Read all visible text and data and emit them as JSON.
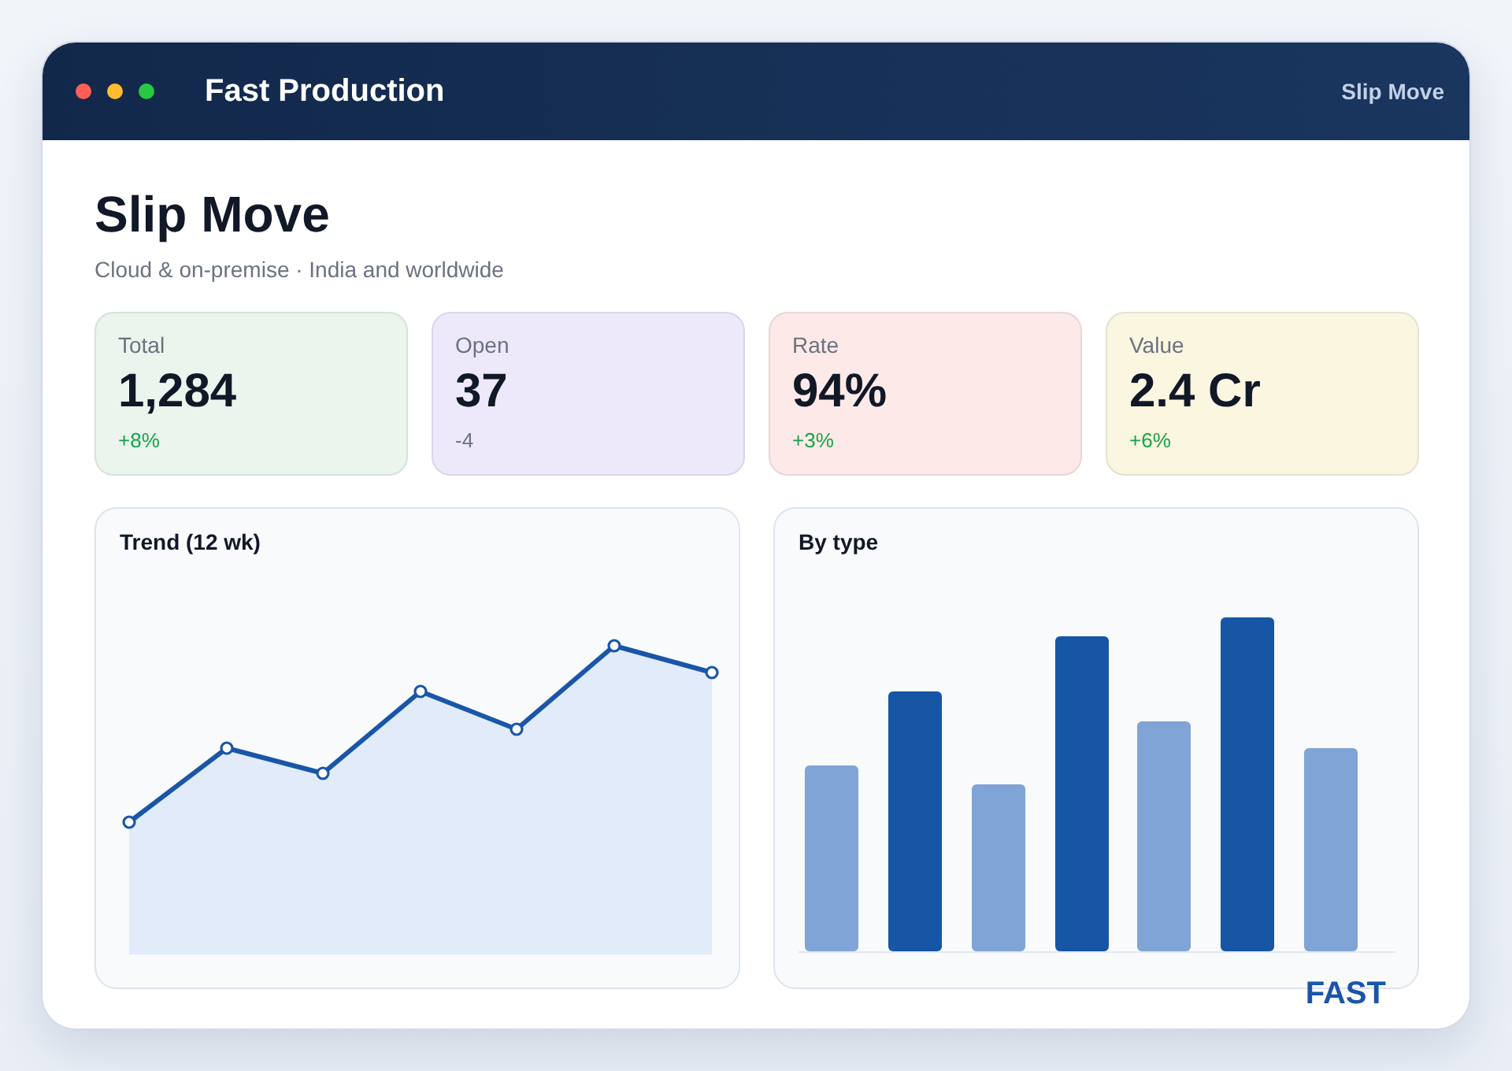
{
  "window": {
    "title": "Fast Production",
    "context": "Slip Move"
  },
  "header": {
    "title": "Slip Move",
    "subtitle": "Cloud & on-premise · India and worldwide"
  },
  "kpis": [
    {
      "label": "Total",
      "value": "1,284",
      "delta": "+8%",
      "positive": true,
      "color": "#ebf5ed"
    },
    {
      "label": "Open",
      "value": "37",
      "delta": "-4",
      "positive": false,
      "color": "#eee9fa"
    },
    {
      "label": "Rate",
      "value": "94%",
      "delta": "+3%",
      "positive": true,
      "color": "#fdeae8"
    },
    {
      "label": "Value",
      "value": "2.4 Cr",
      "delta": "+6%",
      "positive": true,
      "color": "#fbf6df"
    }
  ],
  "charts": [
    {
      "kind": "line",
      "title": "Trend (12 wk)"
    },
    {
      "kind": "bar",
      "title": "By type"
    }
  ],
  "footer": {
    "logo": "FAST"
  }
}
